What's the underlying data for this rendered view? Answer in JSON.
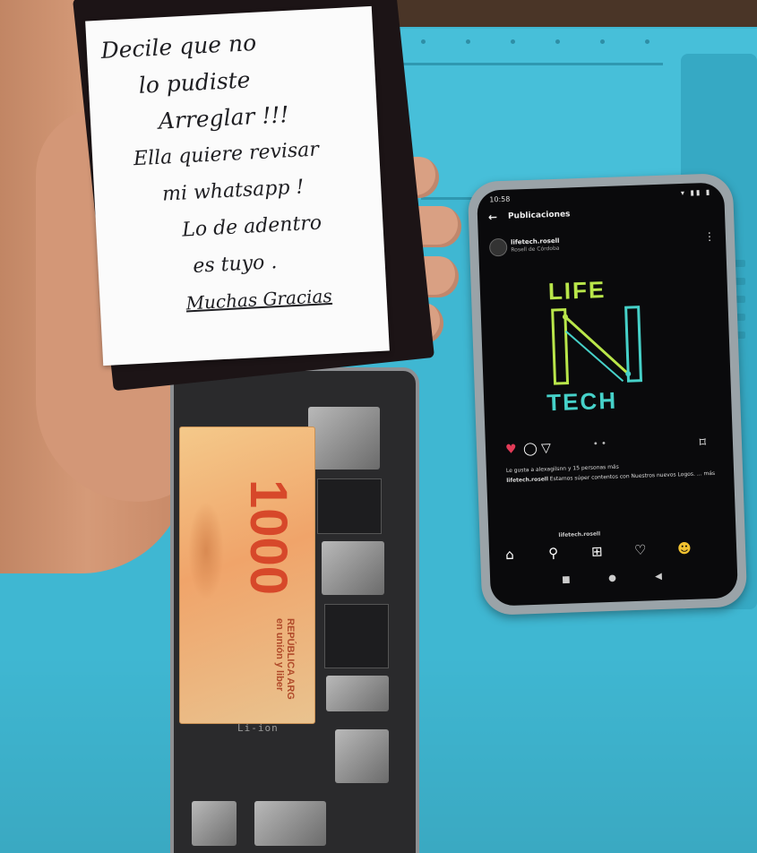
{
  "note": {
    "lines": [
      "Decile que no",
      "lo pudiste",
      "Arreglar !!!",
      "Ella quiere revisar",
      "mi whatsapp !",
      "Lo de adentro",
      "es tuyo .",
      "Muchas Gracias"
    ]
  },
  "banknote": {
    "value": "1000",
    "text_line1": "REPÚBLICA ARG",
    "text_line2": "en unión y liber"
  },
  "battery": {
    "label": "Li-ion"
  },
  "android": {
    "status": {
      "time": "10:58",
      "icons": "▾ ▮▮ ▮"
    },
    "instagram": {
      "header_title": "Publicaciones",
      "header_subtitle": "",
      "account_name": "lifetech.rosell",
      "account_location": "Rosell de Córdoba",
      "logo": {
        "top": "LIFE",
        "bottom": "TECH"
      },
      "likes_text": "Le gusta a alexagilsnn y 15 personas más",
      "caption_user": "lifetech.rosell",
      "caption_text": "Estamos súper contentos con Nuestros nuevos Logos. ",
      "caption_more": "... más",
      "tab_username": "lifetech.rosell"
    },
    "icons": {
      "back": "←",
      "more": "⋮",
      "heart": "♥",
      "comment": "◯",
      "share": "▽",
      "dots": "• •",
      "save": "⌑",
      "home": "⌂",
      "search": "⚲",
      "add": "⊞",
      "activity": "♡",
      "profile": "☻",
      "nav_square": "■",
      "nav_circle": "●",
      "nav_back": "◀"
    }
  },
  "colors": {
    "mat": "#3fb7d2",
    "logo_green": "#b9e64a",
    "logo_teal": "#46d1c9",
    "heart": "#e23b57"
  }
}
